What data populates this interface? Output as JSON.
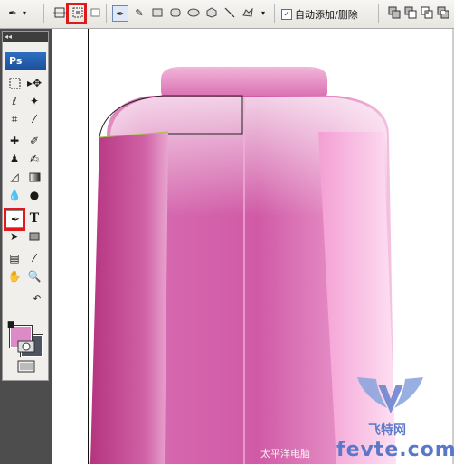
{
  "options_bar": {
    "auto_add_delete_label": "自动添加/删除",
    "auto_add_delete_checked": true,
    "icons": [
      "pen-tool-icon",
      "shape-layers-icon",
      "paths-icon",
      "fill-pixels-icon",
      "pen-icon",
      "freeform-pen-icon",
      "rectangle-icon",
      "rounded-rectangle-icon",
      "ellipse-icon",
      "polygon-icon",
      "line-icon",
      "custom-shape-icon",
      "add-to-shape-area-icon",
      "subtract-icon",
      "intersect-icon",
      "exclude-icon"
    ]
  },
  "toolbox": {
    "collapse_label": "◂◂",
    "logo": "Ps",
    "type_tool_glyph": "T",
    "foreground_color": "#dc8bc6",
    "background_color": "#4c5560"
  },
  "canvas": {
    "object_colors": {
      "main": "#d05aa6",
      "light": "#f4a9d6",
      "dark": "#b93a86",
      "top": "#e68fc3"
    }
  },
  "watermark": {
    "site_text": "太平洋电脑",
    "brand_cn": "飞特网",
    "brand_en": "fevte.com"
  },
  "highlight_color": "#e0191d"
}
